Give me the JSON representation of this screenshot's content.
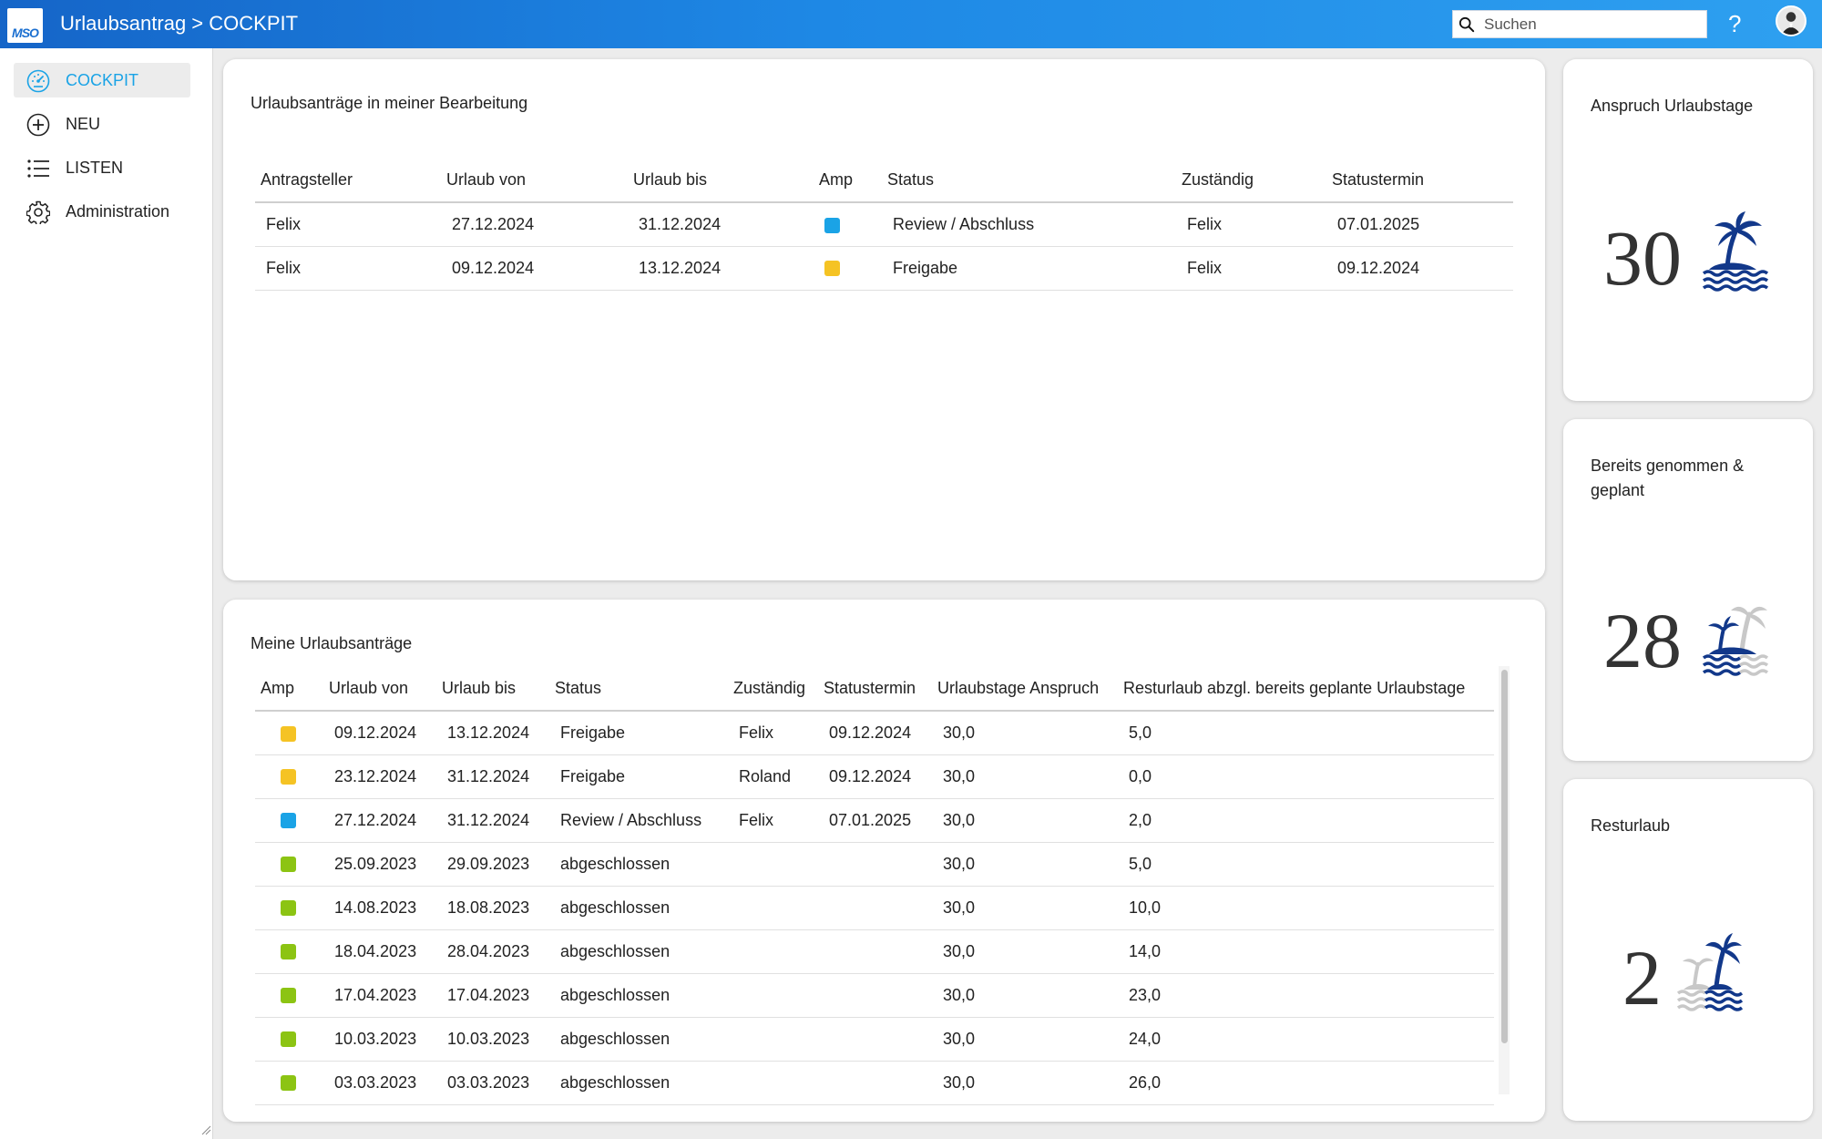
{
  "header": {
    "logo_text": "MSO",
    "title": "Urlaubsantrag > COCKPIT",
    "search_placeholder": "Suchen",
    "help_glyph": "?"
  },
  "sidebar": {
    "items": [
      {
        "label": "COCKPIT",
        "icon": "dashboard-icon",
        "active": true
      },
      {
        "label": "NEU",
        "icon": "plus-circle-icon"
      },
      {
        "label": "LISTEN",
        "icon": "list-icon"
      },
      {
        "label": "Administration",
        "icon": "gear-icon"
      }
    ]
  },
  "colors": {
    "accent": "#1aa3e6",
    "amp_blue": "#1aa3e6",
    "amp_yellow": "#f5c324",
    "amp_green": "#8cc413",
    "icon_blue": "#12388a",
    "icon_grey": "#c8c8c8"
  },
  "bearbeitung": {
    "title": "Urlaubsanträge in meiner Bearbeitung",
    "columns": [
      "Antragsteller",
      "Urlaub von",
      "Urlaub bis",
      "Amp",
      "Status",
      "Zuständig",
      "Statustermin"
    ],
    "rows": [
      {
        "antragsteller": "Felix",
        "von": "27.12.2024",
        "bis": "31.12.2024",
        "amp": "blue",
        "status": "Review / Abschluss",
        "zustaendig": "Felix",
        "termin": "07.01.2025"
      },
      {
        "antragsteller": "Felix",
        "von": "09.12.2024",
        "bis": "13.12.2024",
        "amp": "yellow",
        "status": "Freigabe",
        "zustaendig": "Felix",
        "termin": "09.12.2024"
      }
    ]
  },
  "meine": {
    "title": "Meine Urlaubsanträge",
    "columns": [
      "Amp",
      "Urlaub von",
      "Urlaub bis",
      "Status",
      "Zuständig",
      "Statustermin",
      "Urlaubstage Anspruch",
      "Resturlaub abzgl. bereits geplante Urlaubstage"
    ],
    "rows": [
      {
        "amp": "yellow",
        "von": "09.12.2024",
        "bis": "13.12.2024",
        "status": "Freigabe",
        "zustaendig": "Felix",
        "termin": "09.12.2024",
        "anspruch": "30,0",
        "rest": "5,0"
      },
      {
        "amp": "yellow",
        "von": "23.12.2024",
        "bis": "31.12.2024",
        "status": "Freigabe",
        "zustaendig": "Roland",
        "termin": "09.12.2024",
        "anspruch": "30,0",
        "rest": "0,0"
      },
      {
        "amp": "blue",
        "von": "27.12.2024",
        "bis": "31.12.2024",
        "status": "Review / Abschluss",
        "zustaendig": "Felix",
        "termin": "07.01.2025",
        "anspruch": "30,0",
        "rest": "2,0"
      },
      {
        "amp": "green",
        "von": "25.09.2023",
        "bis": "29.09.2023",
        "status": "abgeschlossen",
        "zustaendig": "",
        "termin": "",
        "anspruch": "30,0",
        "rest": "5,0"
      },
      {
        "amp": "green",
        "von": "14.08.2023",
        "bis": "18.08.2023",
        "status": "abgeschlossen",
        "zustaendig": "",
        "termin": "",
        "anspruch": "30,0",
        "rest": "10,0"
      },
      {
        "amp": "green",
        "von": "18.04.2023",
        "bis": "28.04.2023",
        "status": "abgeschlossen",
        "zustaendig": "",
        "termin": "",
        "anspruch": "30,0",
        "rest": "14,0"
      },
      {
        "amp": "green",
        "von": "17.04.2023",
        "bis": "17.04.2023",
        "status": "abgeschlossen",
        "zustaendig": "",
        "termin": "",
        "anspruch": "30,0",
        "rest": "23,0"
      },
      {
        "amp": "green",
        "von": "10.03.2023",
        "bis": "10.03.2023",
        "status": "abgeschlossen",
        "zustaendig": "",
        "termin": "",
        "anspruch": "30,0",
        "rest": "24,0"
      },
      {
        "amp": "green",
        "von": "03.03.2023",
        "bis": "03.03.2023",
        "status": "abgeschlossen",
        "zustaendig": "",
        "termin": "",
        "anspruch": "30,0",
        "rest": "26,0"
      }
    ]
  },
  "kpis": [
    {
      "title": "Anspruch Urlaubstage",
      "value": "30",
      "icon": "island-icon-full"
    },
    {
      "title": "Bereits genommen & geplant",
      "value": "28",
      "icon": "island-icon-mostly"
    },
    {
      "title": "Resturlaub",
      "value": "2",
      "icon": "island-icon-little"
    }
  ]
}
